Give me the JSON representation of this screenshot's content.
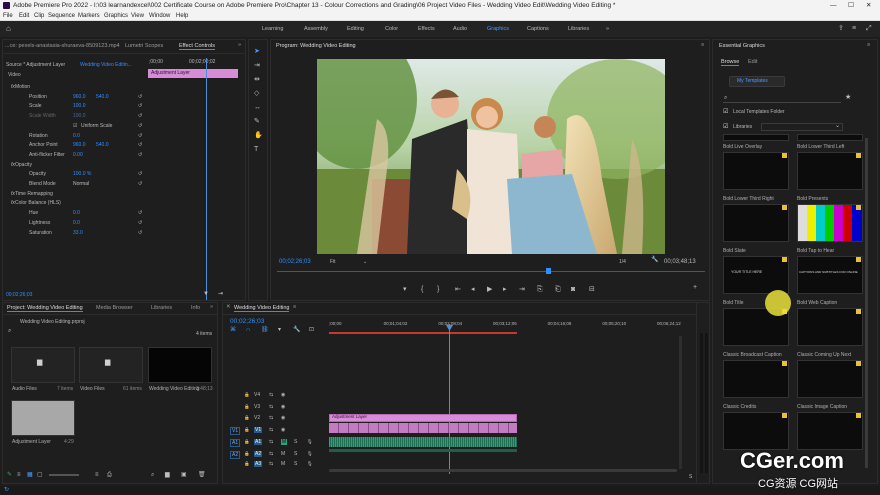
{
  "app": {
    "title": "Adobe Premiere Pro 2022 - I:\\03 learnandexcel\\002 Certificate Course on Adobe Premiere Pro\\Chapter 13 - Colour Corrections and Grading\\06 Project Video Files - Wedding Video Edit\\Wedding Video Editing *"
  },
  "menu": [
    "File",
    "Edit",
    "Clip",
    "Sequence",
    "Markers",
    "Graphics",
    "View",
    "Window",
    "Help"
  ],
  "workspaces": [
    "Learning",
    "Assembly",
    "Editing",
    "Color",
    "Effects",
    "Audio",
    "Graphics",
    "Captions",
    "Libraries"
  ],
  "active_workspace": "Graphics",
  "effect_controls": {
    "tabs": [
      "...ce: pexels-anastasia-shuraeva-8509123.mp4",
      "Lumetri Scopes",
      "Effect Controls"
    ],
    "source": "Source * Adjustment Layer",
    "sequence": "Wedding Video Editin...",
    "ruler_start": ";00;00",
    "ruler_mid": "00;02;00;02",
    "clip_name": "Adjustment Layer",
    "section_video": "Video",
    "rows": [
      {
        "name": "Motion",
        "indent": 1,
        "fx": true
      },
      {
        "name": "Position",
        "value": "960.0",
        "value2": "540.0"
      },
      {
        "name": "Scale",
        "value": "100.0"
      },
      {
        "name": "Scale Width",
        "value": "100.0",
        "dim": true
      },
      {
        "name": "Uniform Scale",
        "check": true
      },
      {
        "name": "Rotation",
        "value": "0.0"
      },
      {
        "name": "Anchor Point",
        "value": "960.0",
        "value2": "540.0"
      },
      {
        "name": "Anti-flicker Filter",
        "value": "0.00"
      },
      {
        "name": "Opacity",
        "indent": 1,
        "fx": true
      },
      {
        "name": "Opacity",
        "value": "100.0 %"
      },
      {
        "name": "Blend Mode",
        "value": "Normal"
      },
      {
        "name": "Time Remapping",
        "indent": 1,
        "fx": true
      },
      {
        "name": "Color Balance (HLS)",
        "indent": 1,
        "fx": true
      },
      {
        "name": "Hue",
        "value": "0.0"
      },
      {
        "name": "Lightness",
        "value": "0.0"
      },
      {
        "name": "Saturation",
        "value": "33.0"
      }
    ],
    "timecode": "00;02;26;03"
  },
  "program": {
    "title": "Program: Wedding Video Editing",
    "timecode": "00;02;26;03",
    "fit": "Fit",
    "fraction": "1/4",
    "duration": "00;03;48;13"
  },
  "project": {
    "tabs": [
      "Project: Wedding Video Editing",
      "Media Browser",
      "Libraries",
      "Info"
    ],
    "file": "Wedding Video Editing.prproj",
    "count": "4 items",
    "items": [
      {
        "name": "Audio Files",
        "meta": "7 items"
      },
      {
        "name": "Video Files",
        "meta": "61 items"
      },
      {
        "name": "Wedding Video Editing",
        "meta": "3:48;13"
      },
      {
        "name": "Adjustment Layer",
        "meta": "4:29"
      }
    ]
  },
  "timeline": {
    "tab": "Wedding Video Editing",
    "timecode": "00;02;26;03",
    "ruler": [
      ";00;00",
      "00;01;04;02",
      "00;02;08;04",
      "00;03;12;06",
      "00;04;16;08",
      "00;05;20;10",
      "00;06;24;12"
    ],
    "tracks": [
      "V4",
      "V3",
      "V2",
      "V1",
      "A1",
      "A2",
      "A3"
    ],
    "source_tracks": [
      "V1",
      "A1",
      "A2"
    ],
    "adjustment_label": "Adjustment Layer",
    "s_labels": [
      "S",
      "S",
      "S"
    ],
    "m_labels": [
      "M",
      "M",
      "M"
    ],
    "s_label": "S"
  },
  "essential_graphics": {
    "title": "Essential Graphics",
    "tabs": [
      "Browse",
      "Edit"
    ],
    "templates_btn": "My Templates",
    "local_templates": "Local Templates Folder",
    "libraries": "Libraries",
    "templates": [
      "Bold Live Overlay",
      "Bold Lower Third Left",
      "Bold Lower Third Right",
      "Bold Presents",
      "Bold Slate",
      "Bold Tap to Hear",
      "Bold Title",
      "Bold Web Caption",
      "Classic Broadcast Caption",
      "Classic Coming Up Next",
      "Classic Credits",
      "Classic Image Caption"
    ],
    "thumb_texts": {
      "title_thumb": "YOUR TITLE HERE",
      "caption_thumb": "CAPTIONS AND SUBTITLES FOR ONLINE"
    }
  },
  "watermark": {
    "line1": "CGer.com",
    "line2": "CG资源 CG网站"
  },
  "colors": {
    "accent": "#2f8fff",
    "adjustment": "#d88bd6",
    "audio": "#2f9e7a",
    "playhead": "#4b8fd8",
    "cursor": "#e9e03a"
  }
}
